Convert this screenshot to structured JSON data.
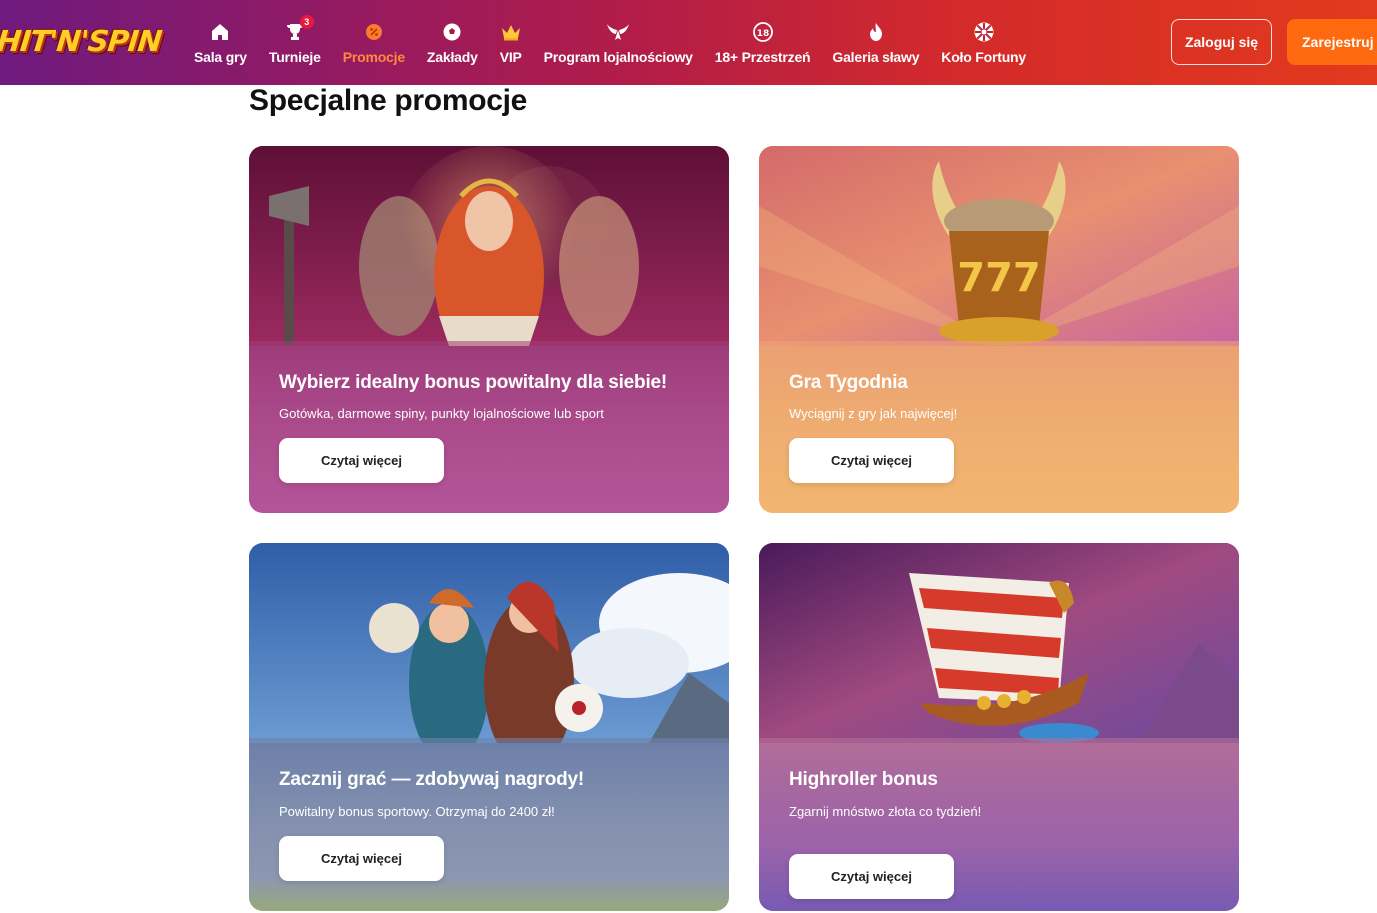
{
  "brand": {
    "logo_text": "HIT'N'SPIN"
  },
  "nav": [
    {
      "id": "sala-gry",
      "label": "Sala gry",
      "icon": "home-icon"
    },
    {
      "id": "turnieje",
      "label": "Turnieje",
      "icon": "trophy-icon",
      "badge": "3"
    },
    {
      "id": "promocje",
      "label": "Promocje",
      "icon": "promo-icon",
      "active": true
    },
    {
      "id": "zaklady",
      "label": "Zakłady",
      "icon": "ball-icon"
    },
    {
      "id": "vip",
      "label": "VIP",
      "icon": "crown-icon"
    },
    {
      "id": "program",
      "label": "Program lojalnościowy",
      "icon": "wings-icon"
    },
    {
      "id": "18plus",
      "label": "18+ Przestrzeń",
      "icon": "eighteen-plus-icon"
    },
    {
      "id": "galeria",
      "label": "Galeria sławy",
      "icon": "flame-icon"
    },
    {
      "id": "kolo",
      "label": "Koło Fortuny",
      "icon": "wheel-icon"
    }
  ],
  "auth": {
    "login_label": "Zaloguj się",
    "register_label": "Zarejestruj się"
  },
  "page": {
    "heading": "Specjalne promocje"
  },
  "promos": [
    {
      "title": "Wybierz idealny bonus powitalny dla siebie!",
      "description": "Gotówka, darmowe spiny, punkty lojalnościowe lub sport",
      "cta": "Czytaj więcej",
      "art": "valkyrie-warriors"
    },
    {
      "title": "Gra Tygodnia",
      "description": "Wyciągnij z gry jak najwięcej!",
      "cta": "Czytaj więcej",
      "art": "viking-777-helmet"
    },
    {
      "title": "Zacznij grać — zdobywaj nagrody!",
      "description": "Powitalny bonus sportowy. Otrzymaj do  2400 zł!",
      "cta": "Czytaj więcej",
      "art": "sport-heroines"
    },
    {
      "title": "Highroller bonus",
      "description": "Zgarnij mnóstwo złota co tydzień!",
      "cta": "Czytaj więcej",
      "art": "viking-ship"
    }
  ],
  "colors": {
    "accent": "#ff6a10",
    "active_nav": "#ff8a3c",
    "badge": "#e8193c"
  }
}
